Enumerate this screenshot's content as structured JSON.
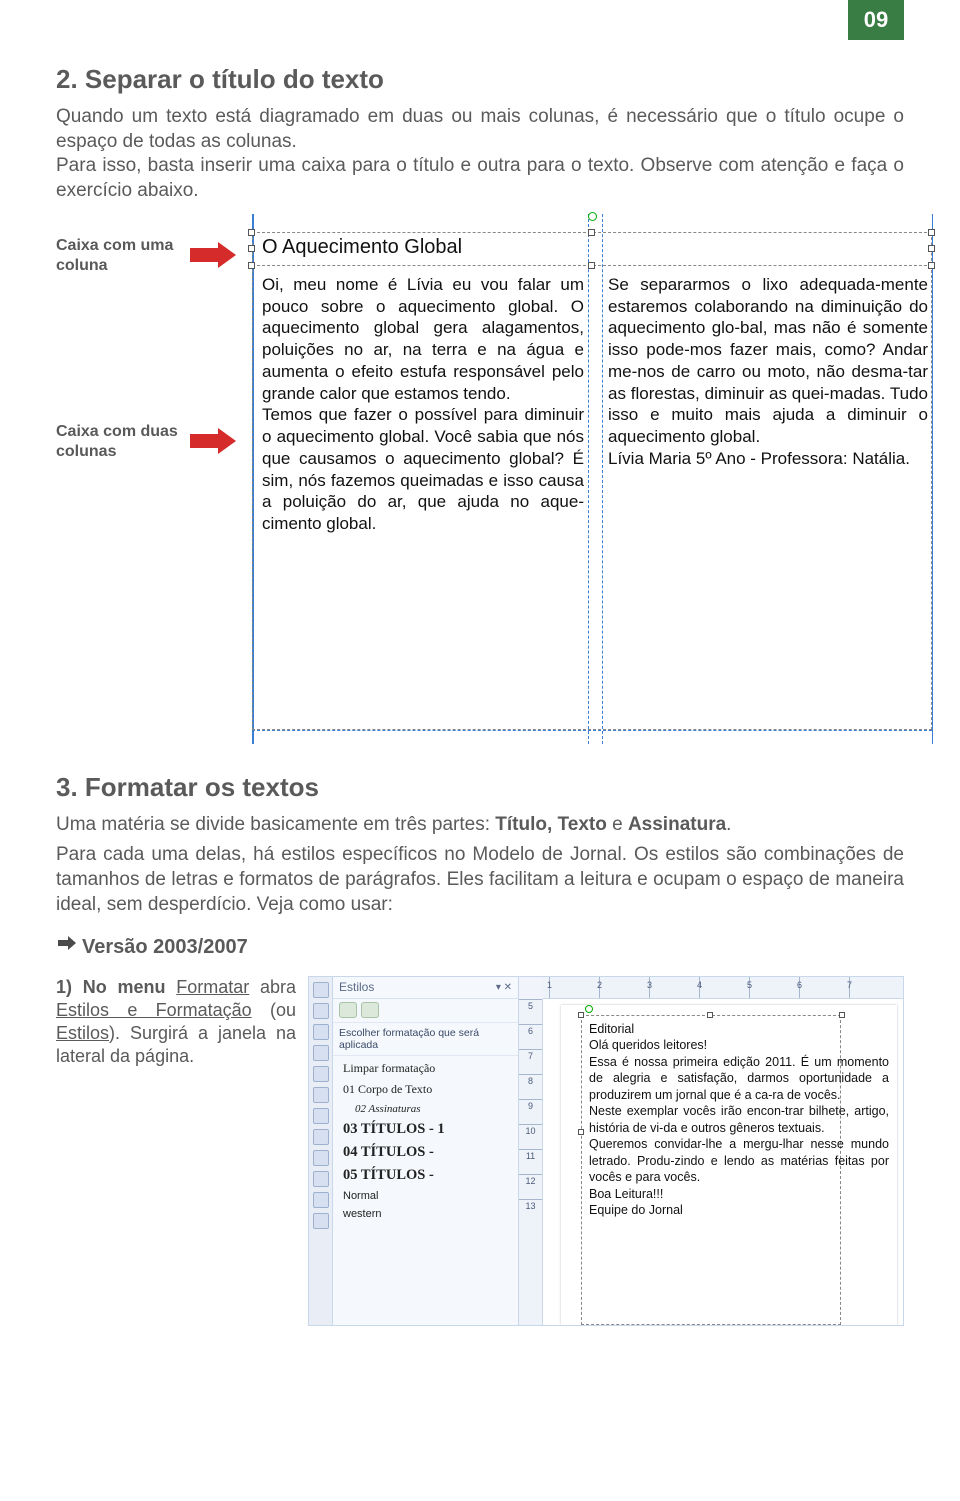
{
  "page_number": "09",
  "sec2": {
    "heading": "2. Separar o título do texto",
    "para": "Quando um texto está diagramado em duas ou mais colunas, é necessário que o título ocupe o espaço de todas as colunas.\nPara isso, basta inserir uma caixa para o título e outra para o texto. Observe com atenção e faça o exercício abaixo."
  },
  "fig1": {
    "label_one": "Caixa com uma coluna",
    "label_two": "Caixa com duas colunas",
    "title": "O Aquecimento Global",
    "col_left": "Oi, meu nome é Lívia eu vou falar um pouco sobre o aquecimento global. O aquecimento global gera alagamentos, poluições no ar, na terra e na água e aumenta o efeito estufa responsável pelo grande calor que estamos tendo.\nTemos que fazer o possível para diminuir o aquecimento global. Você sabia que nós que causamos o aquecimento global? É sim, nós fazemos queimadas e isso causa a poluição do ar, que ajuda no aque-cimento global.",
    "col_right": "Se separarmos o lixo adequada-mente estaremos colaborando na diminuição do aquecimento glo-bal, mas não é somente isso pode-mos fazer mais, como? Andar me-nos de carro ou moto, não desma-tar as florestas, diminuir as quei-madas. Tudo isso e muito mais ajuda a diminuir o aquecimento global.\nLívia Maria 5º Ano - Professora: Natália."
  },
  "sec3": {
    "heading": "3. Formatar os textos",
    "para1_pre": "Uma matéria se divide basicamente em três partes: ",
    "para1_bold": "Título, Texto",
    "para1_mid": " e ",
    "para1_bold2": "Assinatura",
    "para1_post": ".",
    "para2": "Para cada uma delas, há estilos específicos no Modelo de Jornal. Os estilos são combinações de tamanhos de letras e formatos de parágrafos. Eles facilitam a leitura e ocupam o espaço de maneira ideal, sem desperdício. Veja como usar:"
  },
  "versao_label": "Versão 2003/2007",
  "step1": {
    "pre": "1) No menu ",
    "u1": "Formatar",
    "mid1": " abra ",
    "u2": "Estilos e Formatação",
    "mid2": " (ou ",
    "u3": "Estilos",
    "post": "). Surgirá a janela na lateral da página."
  },
  "shot": {
    "styles_title": "Estilos",
    "desc": "Escolher formatação que será aplicada",
    "items": {
      "a": "Limpar formatação",
      "b": "01 Corpo de Texto",
      "c": "02 Assinaturas",
      "d": "03 TÍTULOS - 1",
      "e": "04 TÍTULOS -",
      "f": "05 TÍTULOS -",
      "g": "Normal",
      "h": "western"
    },
    "ruler_top": [
      "1",
      "2",
      "3",
      "4",
      "5",
      "6",
      "7"
    ],
    "ruler_left": [
      "5",
      "6",
      "7",
      "8",
      "9",
      "10",
      "11",
      "12",
      "13"
    ],
    "doc_text": "Editorial\nOlá queridos leitores!\nEssa é nossa primeira edição 2011. É um momento de alegria e satisfação, darmos oportunidade a produzirem um jornal que é a ca-ra de vocês.\nNeste exemplar vocês irão encon-trar bilhete, artigo, história de vi-da e outros gêneros textuais.\nQueremos convidar-lhe a mergu-lhar nesse mundo letrado. Produ-zindo e lendo as matérias feitas por vocês e para vocês.\nBoa Leitura!!!\nEquipe do Jornal"
  }
}
